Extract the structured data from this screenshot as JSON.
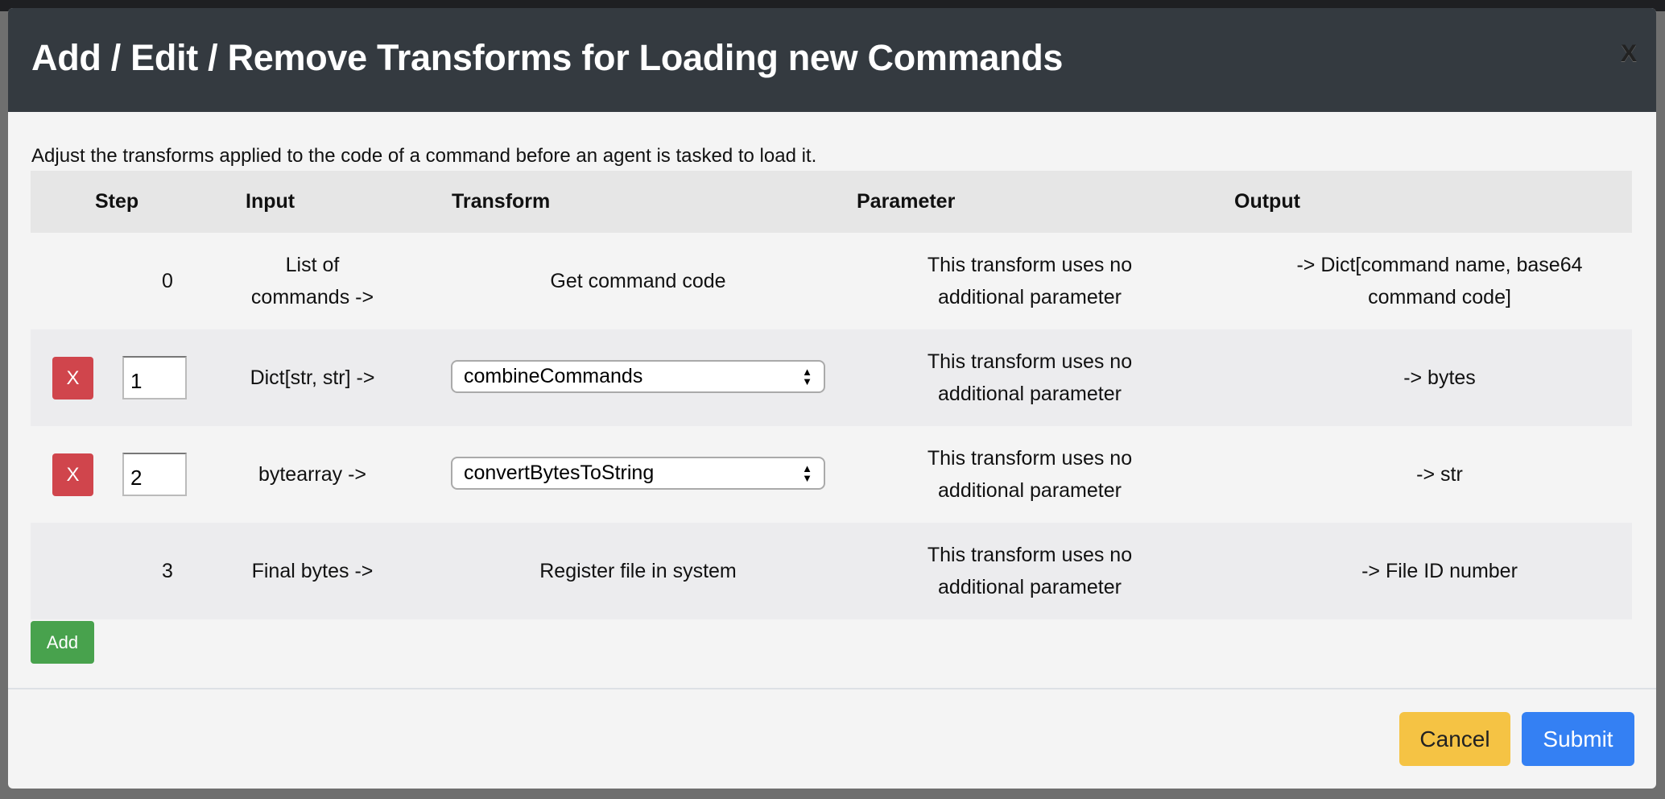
{
  "modal": {
    "title": "Add / Edit / Remove Transforms for Loading new Commands",
    "close_label": "X",
    "description": "Adjust the transforms applied to the code of a command before an agent is tasked to load it."
  },
  "table": {
    "headers": {
      "step": "Step",
      "input": "Input",
      "transform": "Transform",
      "parameter": "Parameter",
      "output": "Output"
    },
    "rows": [
      {
        "step": "0",
        "input": "List of commands ->",
        "transform": "Get command code",
        "parameter": "This transform uses no additional parameter",
        "output": "-> Dict[command name, base64 command code]"
      },
      {
        "remove": "X",
        "step": "1",
        "input": "Dict[str, str] ->",
        "transform": "combineCommands",
        "parameter": "This transform uses no additional parameter",
        "output": "-> bytes"
      },
      {
        "remove": "X",
        "step": "2",
        "input": "bytearray ->",
        "transform": "convertBytesToString",
        "parameter": "This transform uses no additional parameter",
        "output": "-> str"
      },
      {
        "step": "3",
        "input": "Final bytes ->",
        "transform": "Register file in system",
        "parameter": "This transform uses no additional parameter",
        "output": "-> File ID number"
      }
    ]
  },
  "buttons": {
    "add": "Add",
    "cancel": "Cancel",
    "submit": "Submit"
  }
}
